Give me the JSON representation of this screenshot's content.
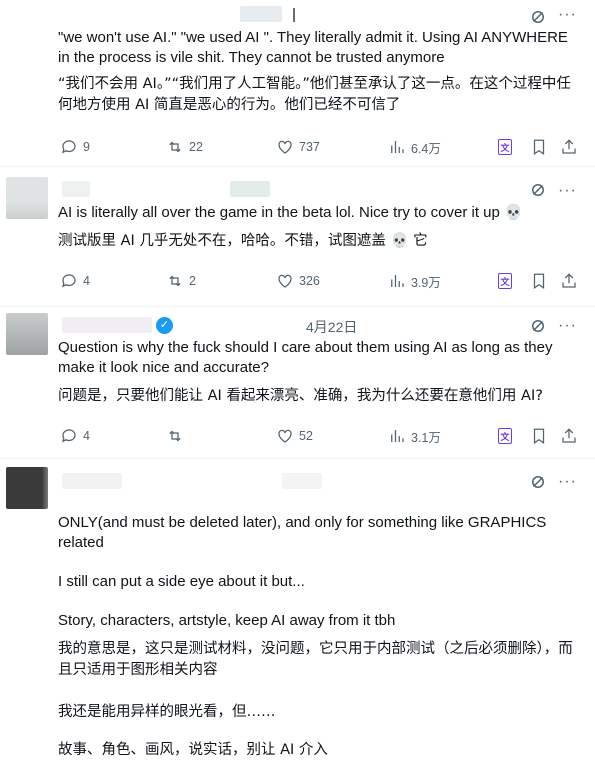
{
  "posts": [
    {
      "text_en": "\"we won't use AI.\" \"we used AI \". They literally admit it. Using AI ANYWHERE in the process is vile shit. They cannot be trusted anymore",
      "text_cn": "“我们不会用 AI。”“我们用了人工智能。”他们甚至承认了这一点。在这个过程中任何地方使用 AI 简直是恶心的行为。他们已经不可信了",
      "replies": "9",
      "reposts": "22",
      "likes": "737",
      "views": "6.4万",
      "date": ""
    },
    {
      "text_en": "AI is literally all over the game in the beta lol. Nice try to cover it up 💀",
      "text_cn": "测试版里 AI 几乎无处不在，哈哈。不错，试图遮盖 💀 它",
      "replies": "4",
      "reposts": "2",
      "likes": "326",
      "views": "3.9万",
      "date": ""
    },
    {
      "text_en": "Question is why the fuck should I care about them using AI as long as they make it look nice and accurate?",
      "text_cn": "问题是，只要他们能让 AI 看起来漂亮、准确，我为什么还要在意他们用 AI?",
      "replies": "4",
      "reposts": "",
      "likes": "52",
      "views": "3.1万",
      "date": "4月22日"
    },
    {
      "text_en_1": "ONLY(and must be deleted later), and only for something like GRAPHICS related",
      "text_en_2": "I still can put a side eye about it but...",
      "text_en_3": "Story, characters, artstyle, keep AI away from it tbh",
      "text_cn_1": "我的意思是，这只是测试材料，没问题，它只用于内部测试（之后必须删除），而且只适用于图形相关内容",
      "text_cn_2": "我还是能用异样的眼光看，但……",
      "text_cn_3": "故事、角色、画风，说实话，别让 AI 介入"
    }
  ],
  "icons": {
    "reply": "reply-icon",
    "repost": "repost-icon",
    "like": "heart-icon",
    "views": "views-icon",
    "translate": "translate-icon",
    "bookmark": "bookmark-icon",
    "share": "share-icon",
    "grok": "grok-icon",
    "more": "more-icon"
  },
  "colors": {
    "verified": "#1d9bf0",
    "muted": "#536471",
    "translate": "#6d3fd2"
  }
}
